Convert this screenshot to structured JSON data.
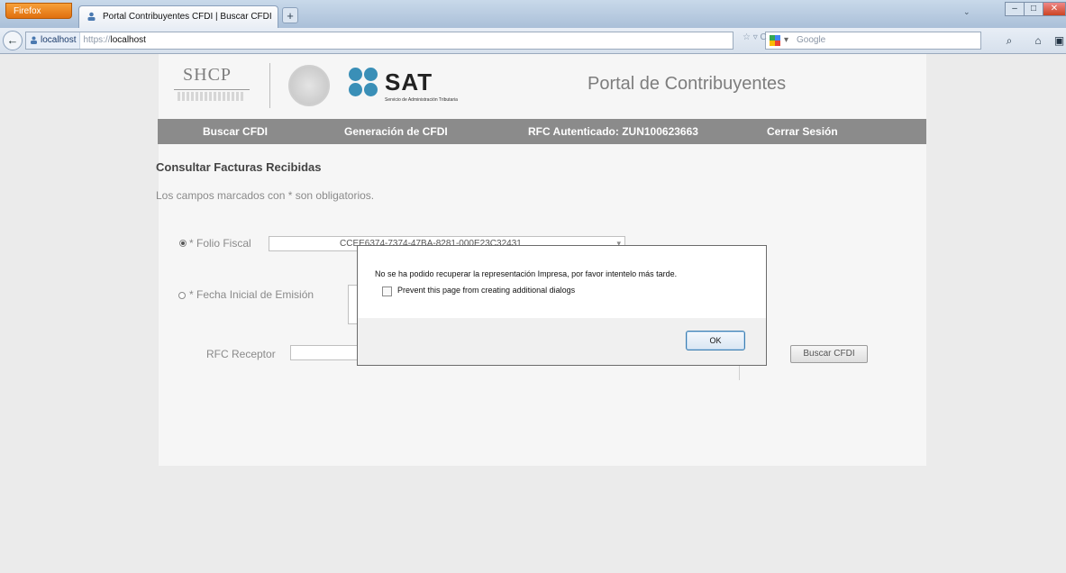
{
  "browser": {
    "app_button": "Firefox",
    "tab_title": "Portal Contribuyentes CFDI | Buscar CFDI",
    "new_tab": "+",
    "url_site": "localhost",
    "url_scheme": "https://",
    "url_host": "localhost",
    "url_icons": "☆ ▿ C",
    "search_placeholder": "Google",
    "search_dropdown": "▾",
    "minimize": "–",
    "maximize": "□",
    "close": "✕",
    "back": "←",
    "search_icon": "⌕",
    "home_icon": "⌂",
    "bookmarks_icon": "▣",
    "tabs_down": "⌄"
  },
  "header": {
    "shcp": "SHCP",
    "sat": "SAT",
    "sat_subtitle": "Servicio de Administración Tributaria",
    "portal_title": "Portal de Contribuyentes"
  },
  "menu": {
    "buscar": "Buscar CFDI",
    "generacion": "Generación de CFDI",
    "rfc": "RFC Autenticado: ZUN100623663",
    "cerrar": "Cerrar Sesión"
  },
  "form": {
    "title": "Consultar Facturas Recibidas",
    "required_note": "Los campos marcados con * son obligatorios.",
    "folio_label": "* Folio Fiscal",
    "folio_value": "CCEE6374-7374-47BA-8281-000E23C32431",
    "fecha_label": "* Fecha Inicial de Emisión",
    "rfc_label": "RFC Receptor",
    "buscar_button": "Buscar CFDI"
  },
  "dialog": {
    "message": "No se ha podido recuperar la representación Impresa, por favor intentelo más tarde.",
    "checkbox_label": "Prevent this page from creating additional dialogs",
    "ok": "OK"
  },
  "colors": {
    "menu_bg": "#8b8b8b",
    "sat_blue": "#3a8fb7"
  }
}
